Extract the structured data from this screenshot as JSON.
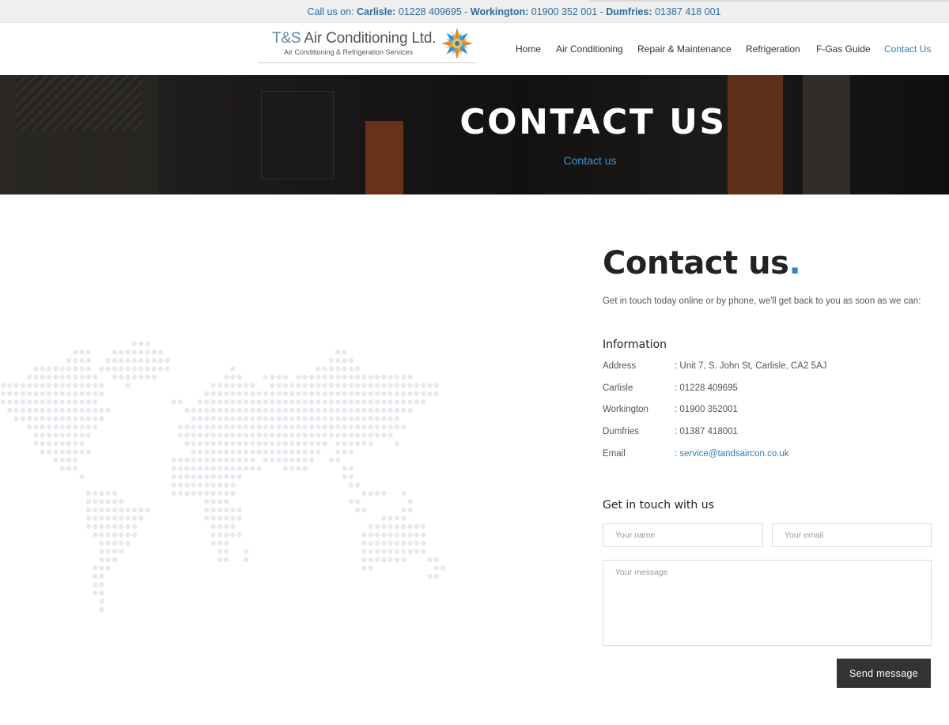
{
  "topbar": {
    "prefix": "Call us on: ",
    "loc1_name": "Carlisle:",
    "loc1_phone": " 01228 409695 - ",
    "loc2_name": "Workington:",
    "loc2_phone": " 01900 352 001 - ",
    "loc3_name": "Dumfries:",
    "loc3_phone": " 01387 418 001"
  },
  "logo": {
    "brand_prefix": "T&S",
    "brand_rest": " Air Conditioning Ltd.",
    "tagline": "Air Conditioning & Refrigeration Services"
  },
  "nav": {
    "items": [
      {
        "label": "Home"
      },
      {
        "label": "Air Conditioning"
      },
      {
        "label": "Repair & Maintenance"
      },
      {
        "label": "Refrigeration"
      },
      {
        "label": "F-Gas Guide"
      },
      {
        "label": "Contact Us"
      }
    ]
  },
  "hero": {
    "title": "CONTACT US",
    "breadcrumb": "Contact us"
  },
  "contact": {
    "heading": "Contact us",
    "heading_dot": ".",
    "intro": "Get in touch today online or by phone, we'll get back to you as soon as we can:",
    "info_title": "Information",
    "info": [
      {
        "label": "Address",
        "value": ": Unit 7, S. John St, Carlisle, CA2 5AJ"
      },
      {
        "label": "Carlisle",
        "value": ": 01228 409695"
      },
      {
        "label": "Workington",
        "value": ": 01900 352001"
      },
      {
        "label": "Dumfries",
        "value": ": 01387 418001"
      },
      {
        "label": "Email",
        "value_prefix": ": ",
        "value": "service@tandsaircon.co.uk"
      }
    ],
    "form_title": "Get in touch with us",
    "form": {
      "name_placeholder": "Your name",
      "email_placeholder": "Your email",
      "message_placeholder": "Your message",
      "send_label": "Send message"
    }
  },
  "colors": {
    "accent": "#2f7eb5",
    "topbar_text": "#2f6aa0",
    "button_bg": "#333333",
    "map_dot": "#e6eaef"
  }
}
